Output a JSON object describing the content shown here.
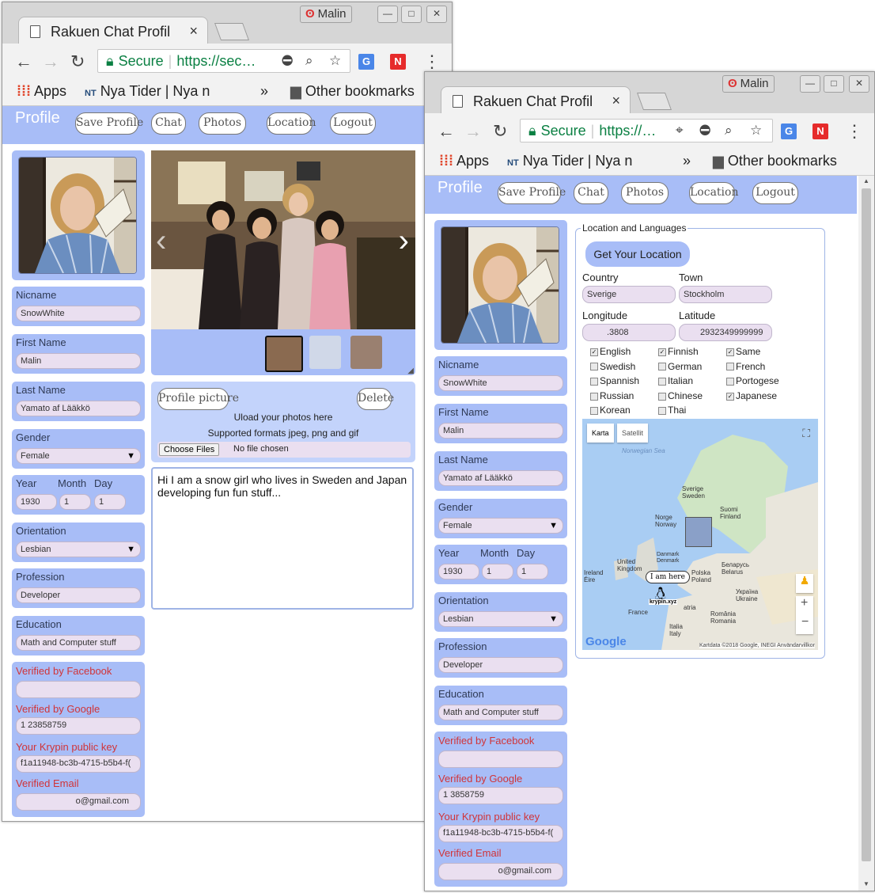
{
  "browser": {
    "tab_title": "Rakuen Chat Profil",
    "user_name": "Malin",
    "secure_label": "Secure",
    "url_a": "https://sec…",
    "url_b": "https://…",
    "bookmarks": {
      "apps": "Apps",
      "nyatider": "Nya Tider | Nya n",
      "nt_badge": "NT",
      "more": "»",
      "other": "Other bookmarks"
    }
  },
  "nav": {
    "brand": "Profile",
    "save_profile": "Save Profile",
    "chat": "Chat",
    "photos": "Photos",
    "location": "Location",
    "logout": "Logout"
  },
  "profile": {
    "nicname_label": "Nicname",
    "nicname": "SnowWhite",
    "first_name_label": "First Name",
    "first_name": "Malin",
    "last_name_label": "Last Name",
    "last_name": "Yamato af Lääkkö",
    "gender_label": "Gender",
    "gender": "Female",
    "year_label": "Year",
    "month_label": "Month",
    "day_label": "Day",
    "year": "1930",
    "month": "1",
    "day": "1",
    "orientation_label": "Orientation",
    "orientation": "Lesbian",
    "profession_label": "Profession",
    "profession": "Developer",
    "education_label": "Education",
    "education": "Math and Computer stuff",
    "verified_facebook_label": "Verified by Facebook",
    "verified_facebook": "",
    "verified_google_label": "Verified by Google",
    "verified_google_a": "1        23858759",
    "verified_google_b": "1            3858759",
    "krypin_key_label": "Your Krypin public key",
    "krypin_key": "f1a11948-bc3b-4715-b5b4-f(",
    "verified_email_label": "Verified Email",
    "verified_email": "o@gmail.com"
  },
  "photos_panel": {
    "profile_picture": "Profile picture",
    "delete": "Delete",
    "upload_text": "Uload your photos here",
    "formats_text": "Supported formats jpeg, png and gif",
    "choose_files": "Choose Files",
    "no_file": "No file chosen",
    "description": "Hi I am a snow girl who lives in Sweden and Japan developing fun fun stuff..."
  },
  "location_panel": {
    "legend": "Location and Languages",
    "get_location": "Get Your Location",
    "country_label": "Country",
    "country": "Sverige",
    "town_label": "Town",
    "town": "Stockholm",
    "longitude_label": "Longitude",
    "longitude": ".3808",
    "latitude_label": "Latitude",
    "latitude": "2932349999999",
    "languages": [
      {
        "name": "English",
        "checked": true
      },
      {
        "name": "Finnish",
        "checked": true
      },
      {
        "name": "Same",
        "checked": true
      },
      {
        "name": "Swedish",
        "checked": false
      },
      {
        "name": "German",
        "checked": false
      },
      {
        "name": "French",
        "checked": false
      },
      {
        "name": "Spannish",
        "checked": false
      },
      {
        "name": "Italian",
        "checked": false
      },
      {
        "name": "Portogese",
        "checked": false
      },
      {
        "name": "Russian",
        "checked": false
      },
      {
        "name": "Chinese",
        "checked": false
      },
      {
        "name": "Japanese",
        "checked": true
      },
      {
        "name": "Korean",
        "checked": false
      },
      {
        "name": "Thai",
        "checked": false
      }
    ],
    "map": {
      "karta": "Karta",
      "satellit": "Satellit",
      "sea": "Norwegian Sea",
      "sweden": "Sverige\nSweden",
      "finland": "Suomi\nFinland",
      "norway": "Norge\nNorway",
      "denmark": "Danmark\nDenmark",
      "uk": "United\nKingdom",
      "ireland": "Ireland\nÉire",
      "poland": "Polska\nPoland",
      "belarus": "Беларусь\nBelarus",
      "ukraine": "Україна\nUkraine",
      "france": "France",
      "austria": "atria",
      "romania": "România\nRomania",
      "italy": "Italia\nItaly",
      "speech": "I am here",
      "tux_label": "krypin.xyz",
      "google": "Google",
      "attribution": "Kartdata ©2018 Google, INEGI   Användarvillkor"
    }
  },
  "colors": {
    "nav_blue": "#a8bdf7",
    "field_pink": "#eadff0",
    "label_red": "#d13438",
    "secure_green": "#0b8043"
  }
}
